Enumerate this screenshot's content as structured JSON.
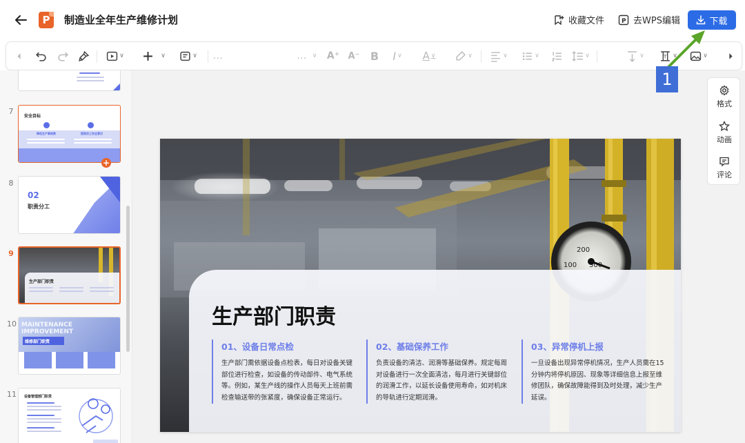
{
  "header": {
    "back_icon": "arrow-left-icon",
    "logo_letter": "P",
    "title": "制造业全年生产维修计划",
    "collect_label": "收藏文件",
    "wps_edit_label": "去WPS编辑",
    "download_label": "下载"
  },
  "toolbar": {
    "icons": [
      "chevron-left-icon",
      "undo-icon",
      "redo-icon",
      "format-painter-icon",
      "play-icon",
      "insert-plus-icon",
      "layout-icon",
      "font-name-dropdown",
      "font-size-dropdown",
      "increase-font-icon",
      "decrease-font-icon",
      "bold-icon",
      "italic-icon",
      "font-color-icon",
      "highlight-icon",
      "align-icon",
      "bullet-list-icon",
      "numbered-list-icon",
      "line-spacing-icon",
      "text-direction-icon",
      "text-box-icon",
      "image-icon",
      "chevron-right-icon"
    ],
    "font_placeholder": "...",
    "size_placeholder": "..."
  },
  "sidebar": {
    "thumbnails": [
      {
        "number": "7",
        "title": "安全目标",
        "sub1": "降低生产事故数",
        "sub2": "提高员工安全意识"
      },
      {
        "number": "8",
        "big": "02",
        "title": "职责分工"
      },
      {
        "number": "9",
        "title": "生产部门职责",
        "active": true
      },
      {
        "number": "10",
        "title": "维修部门职责",
        "banner": "MAINTENANCE IMPROVEMENT"
      },
      {
        "number": "11",
        "title": "设备管理部门职责"
      }
    ]
  },
  "right_panel": {
    "format_label": "格式",
    "animation_label": "动画",
    "comment_label": "评论"
  },
  "slide": {
    "title": "生产部门职责",
    "gauge_labels": [
      "100",
      "200",
      "300"
    ],
    "columns": [
      {
        "head": "01、设备日常点检",
        "body": "生产部门需依据设备点检表，每日对设备关键部位进行检查，如设备的传动部件、电气系统等。例如，某生产线的操作人员每天上班前需检查输送带的张紧度，确保设备正常运行。"
      },
      {
        "head": "02、基础保养工作",
        "body": "负责设备的清洁、润滑等基础保养。规定每周对设备进行一次全面清洁，每月进行关键部位的润滑工作，以延长设备使用寿命，如对机床的导轨进行定期润滑。"
      },
      {
        "head": "03、异常停机上报",
        "body": "一旦设备出现异常停机情况，生产人员需在15分钟内将停机原因、现象等详细信息上报至维修团队，确保故障能得到及时处理，减少生产延误。"
      }
    ]
  },
  "annotation": {
    "number": "1"
  },
  "colors": {
    "accent": "#2b6be6",
    "brand": "#e8642a",
    "slide_accent": "#6d7ee8",
    "annotation_arrow": "#5aa52a"
  }
}
